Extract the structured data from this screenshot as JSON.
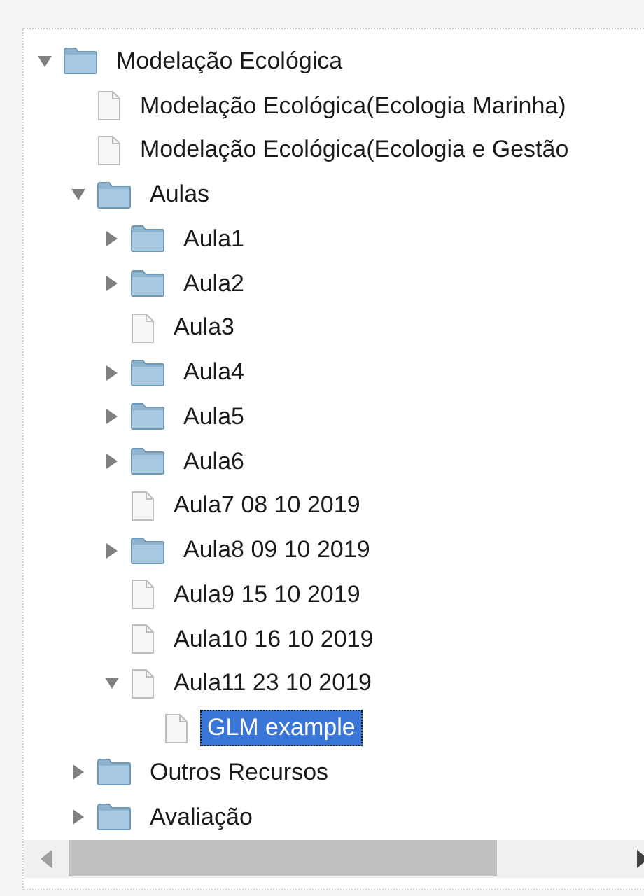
{
  "tree": [
    {
      "label": "Modelação Ecológica",
      "kind": "folder",
      "expanded": true,
      "selected": false,
      "children": [
        {
          "label": "Modelação Ecológica(Ecologia Marinha)",
          "kind": "file",
          "selected": false
        },
        {
          "label": "Modelação Ecológica(Ecologia e Gestão",
          "kind": "file",
          "selected": false
        },
        {
          "label": "Aulas",
          "kind": "folder",
          "expanded": true,
          "selected": false,
          "children": [
            {
              "label": "Aula1",
              "kind": "folder",
              "expanded": false,
              "selected": false
            },
            {
              "label": "Aula2",
              "kind": "folder",
              "expanded": false,
              "selected": false
            },
            {
              "label": "Aula3",
              "kind": "file",
              "selected": false
            },
            {
              "label": "Aula4",
              "kind": "folder",
              "expanded": false,
              "selected": false
            },
            {
              "label": "Aula5",
              "kind": "folder",
              "expanded": false,
              "selected": false
            },
            {
              "label": "Aula6",
              "kind": "folder",
              "expanded": false,
              "selected": false
            },
            {
              "label": "Aula7 08 10 2019",
              "kind": "file",
              "selected": false
            },
            {
              "label": "Aula8 09 10 2019",
              "kind": "folder",
              "expanded": false,
              "selected": false
            },
            {
              "label": "Aula9 15 10 2019",
              "kind": "file",
              "selected": false
            },
            {
              "label": "Aula10 16 10 2019",
              "kind": "file",
              "selected": false
            },
            {
              "label": "Aula11 23 10 2019",
              "kind": "file",
              "expanded": true,
              "selected": false,
              "children": [
                {
                  "label": "GLM example",
                  "kind": "file",
                  "selected": true
                }
              ]
            }
          ]
        },
        {
          "label": "Outros Recursos",
          "kind": "folder",
          "expanded": false,
          "selected": false
        },
        {
          "label": "Avaliação",
          "kind": "folder",
          "expanded": false,
          "selected": false
        }
      ]
    }
  ]
}
